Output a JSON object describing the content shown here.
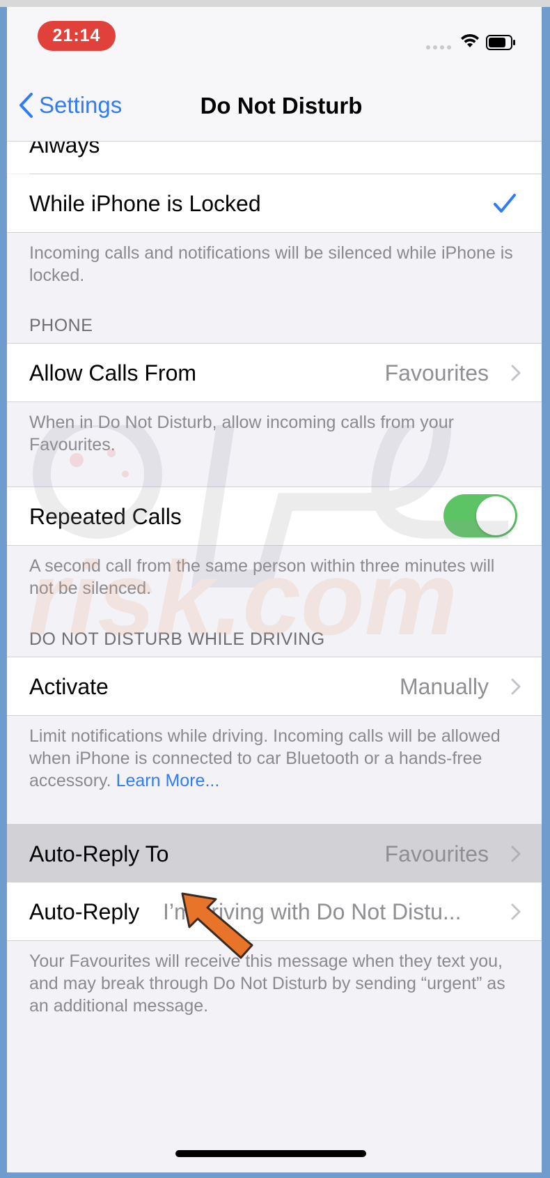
{
  "status_bar": {
    "time": "21:14",
    "icons": [
      "signal-dots-icon",
      "wifi-icon",
      "battery-icon"
    ]
  },
  "nav": {
    "back_label": "Settings",
    "title": "Do Not Disturb"
  },
  "silence": {
    "partial_row_label": "Always",
    "locked_row_label": "While iPhone is Locked",
    "locked_selected": true,
    "footer": "Incoming calls and notifications will be silenced while iPhone is locked."
  },
  "phone": {
    "header": "PHONE",
    "allow_calls_label": "Allow Calls From",
    "allow_calls_value": "Favourites",
    "allow_calls_footer": "When in Do Not Disturb, allow incoming calls from your Favourites.",
    "repeated_calls_label": "Repeated Calls",
    "repeated_calls_on": true,
    "repeated_calls_footer": "A second call from the same person within three minutes will not be silenced."
  },
  "driving": {
    "header": "DO NOT DISTURB WHILE DRIVING",
    "activate_label": "Activate",
    "activate_value": "Manually",
    "footer": "Limit notifications while driving. Incoming calls will be allowed when iPhone is connected to car Bluetooth or a hands-free accessory.",
    "learn_more": "Learn More..."
  },
  "auto_reply": {
    "to_label": "Auto-Reply To",
    "to_value": "Favourites",
    "reply_label": "Auto-Reply",
    "reply_value": "I’m driving with Do Not Distu...",
    "footer": "Your Favourites will receive this message when they text you, and may break through Do Not Disturb by sending “urgent” as an additional message."
  },
  "colors": {
    "accent": "#2f7cf6",
    "toggle_on": "#5dc466",
    "time_pill": "#e0413a",
    "highlight_row": "#d1d1d6",
    "annotation_arrow": "#e8742a"
  }
}
